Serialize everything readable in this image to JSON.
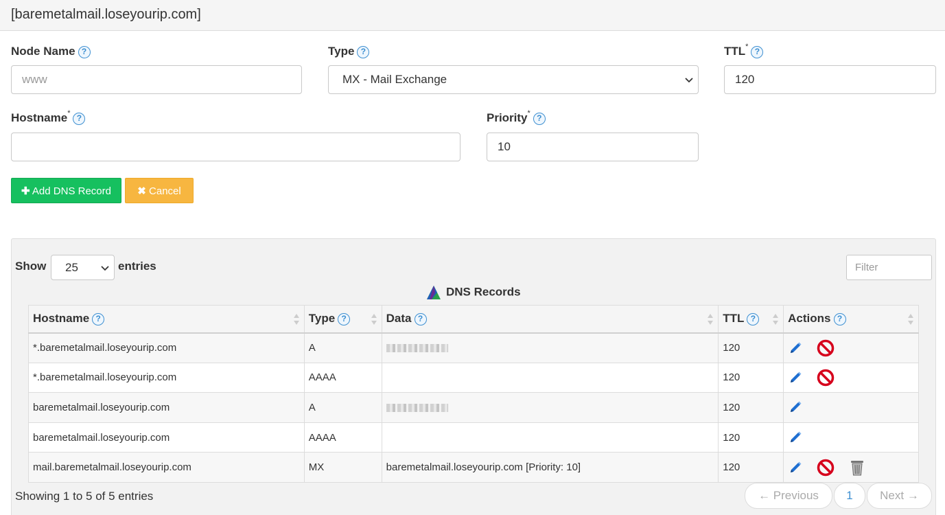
{
  "header": {
    "title": "[baremetalmail.loseyourip.com]"
  },
  "form": {
    "node_name": {
      "label": "Node Name",
      "placeholder": "www",
      "value": ""
    },
    "type": {
      "label": "Type",
      "value": "MX - Mail Exchange"
    },
    "ttl": {
      "label": "TTL",
      "required": "*",
      "value": "120"
    },
    "hostname": {
      "label": "Hostname",
      "required": "*",
      "value": ""
    },
    "priority": {
      "label": "Priority",
      "required": "*",
      "value": "10"
    },
    "help_glyph": "?"
  },
  "buttons": {
    "add": "Add DNS Record",
    "cancel": "Cancel"
  },
  "table_controls": {
    "show": "Show",
    "entries_value": "25",
    "entries": "entries",
    "filter_placeholder": "Filter"
  },
  "table": {
    "title": "DNS Records",
    "columns": [
      "Hostname",
      "Type",
      "Data",
      "TTL",
      "Actions"
    ],
    "rows": [
      {
        "hostname": "*.baremetalmail.loseyourip.com",
        "type": "A",
        "data": "",
        "ttl": "120",
        "actions": [
          "edit-icon",
          "disable-icon"
        ]
      },
      {
        "hostname": "*.baremetalmail.loseyourip.com",
        "type": "AAAA",
        "data": "",
        "ttl": "120",
        "actions": [
          "edit-icon",
          "disable-icon"
        ]
      },
      {
        "hostname": "baremetalmail.loseyourip.com",
        "type": "A",
        "data": "",
        "ttl": "120",
        "actions": [
          "edit-icon"
        ]
      },
      {
        "hostname": "baremetalmail.loseyourip.com",
        "type": "AAAA",
        "data": "",
        "ttl": "120",
        "actions": [
          "edit-icon"
        ]
      },
      {
        "hostname": "mail.baremetalmail.loseyourip.com",
        "type": "MX",
        "data": "baremetalmail.loseyourip.com [Priority: 10]",
        "ttl": "120",
        "actions": [
          "edit-icon",
          "disable-icon",
          "trash-icon"
        ]
      }
    ]
  },
  "footer": {
    "info": "Showing 1 to 5 of 5 entries",
    "previous": "← Previous",
    "page": "1",
    "next": "Next →"
  },
  "colors": {
    "add_button": "#16c05f",
    "cancel_button": "#f7b640",
    "help_icon": "#3d8fd1",
    "disable_icon": "#d6001c",
    "edit_icon": "#1f6fd1"
  }
}
